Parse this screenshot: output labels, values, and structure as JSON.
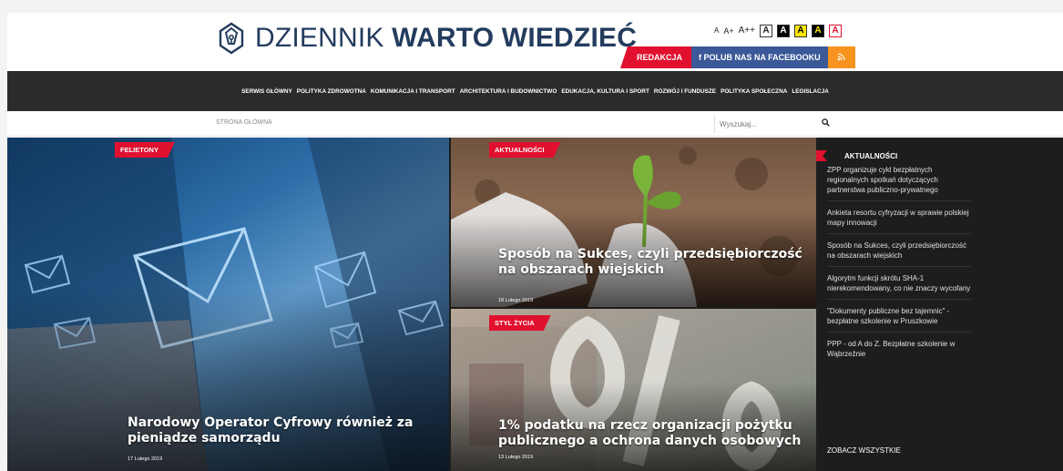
{
  "header": {
    "logo_light": "DZIENNIK ",
    "logo_bold": "WARTO WIEDZIEĆ",
    "font_sizes": [
      "A",
      "A+",
      "A++"
    ],
    "contrast_buttons": [
      "A",
      "A",
      "A",
      "A",
      "A"
    ],
    "redakcja_label": "REDAKCJA",
    "facebook_label": "f POLUB NAS NA FACEBOOKU",
    "rss_label": "))"
  },
  "nav": {
    "items": [
      "SERWIS GŁÓWNY",
      "POLITYKA ZDROWOTNA",
      "KOMUNIKACJA I TRANSPORT",
      "ARCHITEKTURA I BUDOWNICTWO",
      "EDUKACJA, KULTURA I SPORT",
      "ROZWÓJ I FUNDUSZE",
      "POLITYKA SPOŁECZNA",
      "LEGISLACJA"
    ]
  },
  "subbar": {
    "breadcrumb": "STRONA GŁÓWNA",
    "search_placeholder": "Wyszukaj..."
  },
  "tiles": [
    {
      "category": "FELIETONY",
      "headline": "Narodowy Operator Cyfrowy również za pieniądze samorządu",
      "date": "17 Lutego 2019"
    },
    {
      "category": "AKTUALNOŚCI",
      "headline": "Sposób na Sukces, czyli przedsiębiorczość na obszarach wiejskich",
      "date": "18 Lutego 2019"
    },
    {
      "category": "STYL ŻYCIA",
      "headline": "1% podatku na rzecz organizacji pożytku publicznego a ochrona danych osobowych",
      "date": "13 Lutego 2019"
    }
  ],
  "sidebar": {
    "title": "AKTUALNOŚCI",
    "items": [
      "ZPP organizuje cykl bezpłatnych regionalnych spotkań dotyczących partnerstwa publiczno-prywatnego",
      "Ankieta resortu cyfryzacji w sprawie polskiej mapy innowacji",
      "Sposób na Sukces, czyli przedsiębiorczość na obszarach wiejskich",
      "Algorytm funkcji skrótu SHA-1 nierekomendowany, co nie znaczy wycofany",
      "\"Dokumenty publiczne bez tajemnic\" - bezpłatne szkolenie w Pruszkowie",
      "PPP - od A do Z. Bezpłatne szkolenie w Wąbrzeźnie"
    ],
    "see_all": "ZOBACZ WSZYSTKIE"
  },
  "colors": {
    "accent": "#e0102e",
    "nav_bg": "#2b2b2b",
    "logo": "#233c5e",
    "facebook": "#3b5998",
    "rss": "#f7931e"
  }
}
